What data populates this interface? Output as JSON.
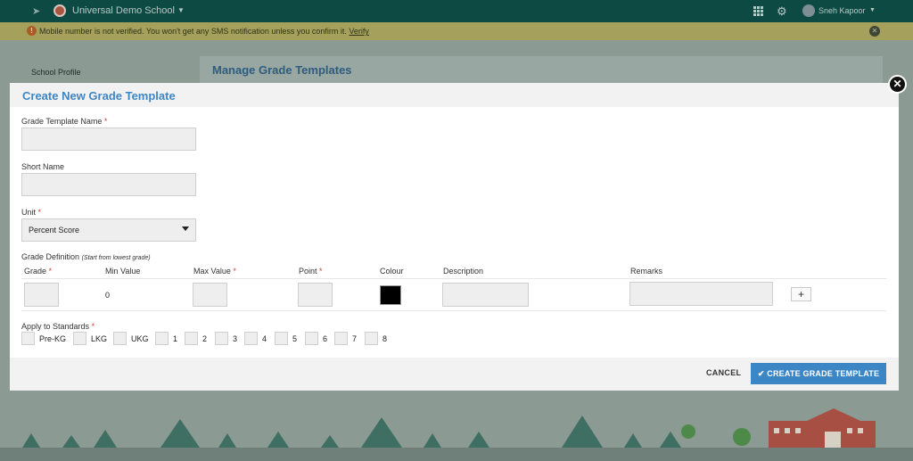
{
  "topbar": {
    "school_name": "Universal Demo School",
    "user_name": "Sneh Kapoor"
  },
  "notice": {
    "message": "Mobile number is not verified. You won't get any SMS notification unless you confirm it.",
    "verify_link": "Verify",
    "warn_glyph": "!",
    "close_glyph": "✕"
  },
  "background": {
    "sidebar_item": "School Profile",
    "page_title": "Manage Grade Templates"
  },
  "modal": {
    "title": "Create New Grade Template",
    "close_glyph": "✕",
    "fields": {
      "template_name_label": "Grade Template Name",
      "template_name_value": "",
      "short_name_label": "Short Name",
      "short_name_value": "",
      "unit_label": "Unit",
      "unit_value": "Percent Score"
    },
    "required_mark": "*",
    "grade_definition": {
      "label": "Grade Definition",
      "hint": "(Start from lowest grade)",
      "columns": {
        "grade": "Grade",
        "min_value": "Min Value",
        "max_value": "Max Value",
        "point": "Point",
        "colour": "Colour",
        "description": "Description",
        "remarks": "Remarks"
      },
      "row": {
        "grade": "",
        "min_value": "0",
        "max_value": "",
        "point": "",
        "colour": "#000000",
        "description": "",
        "remarks": ""
      },
      "add_glyph": "+"
    },
    "standards": {
      "label": "Apply to Standards",
      "items": [
        "Pre-KG",
        "LKG",
        "UKG",
        "1",
        "2",
        "3",
        "4",
        "5",
        "6",
        "7",
        "8"
      ]
    },
    "footer": {
      "cancel_label": "CANCEL",
      "create_label": "✔ CREATE GRADE TEMPLATE"
    }
  },
  "colors": {
    "accent": "#3d86c6",
    "required": "#d43c3c",
    "topbar": "#0d4a44"
  }
}
